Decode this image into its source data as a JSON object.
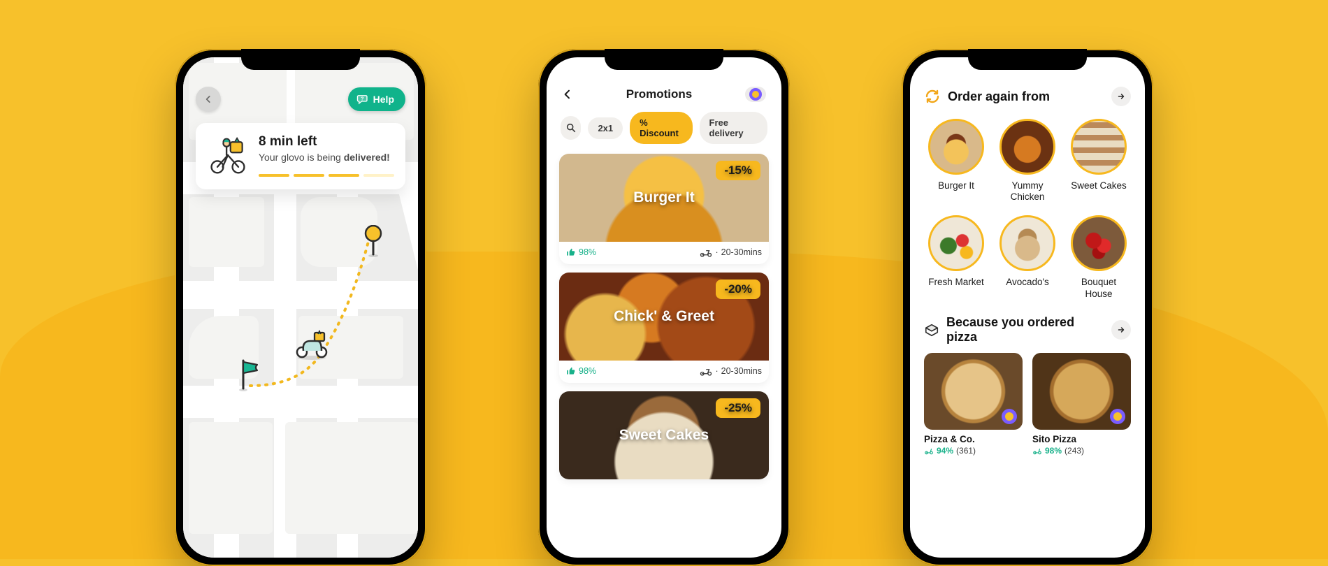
{
  "colors": {
    "accent": "#f7b81e",
    "green": "#10b38b",
    "text": "#1b1b1b"
  },
  "tracking": {
    "help_label": "Help",
    "title": "8 min left",
    "subtitle_prefix": "Your glovo is being ",
    "subtitle_bold": "delivered!"
  },
  "promotions": {
    "header_title": "Promotions",
    "filters": {
      "two_for_one": "2x1",
      "discount": "% Discount",
      "free_delivery": "Free delivery"
    },
    "cards": [
      {
        "name": "Burger It",
        "discount": "-15%",
        "rating": "98%",
        "delivery": "20-30mins"
      },
      {
        "name": "Chick' & Greet",
        "discount": "-20%",
        "rating": "98%",
        "delivery": "20-30mins"
      },
      {
        "name": "Sweet Cakes",
        "discount": "-25%"
      }
    ]
  },
  "order_again": {
    "title": "Order again from",
    "items": [
      {
        "label": "Burger It"
      },
      {
        "label": "Yummy Chicken"
      },
      {
        "label": "Sweet Cakes"
      },
      {
        "label": "Fresh Market"
      },
      {
        "label": "Avocado's"
      },
      {
        "label": "Bouquet House"
      }
    ]
  },
  "because_ordered": {
    "title": "Because you ordered pizza",
    "cards": [
      {
        "name": "Pizza & Co.",
        "rating_pct": "94%",
        "rating_count": "(361)"
      },
      {
        "name": "Sito Pizza",
        "rating_pct": "98%",
        "rating_count": "(243)"
      }
    ]
  }
}
